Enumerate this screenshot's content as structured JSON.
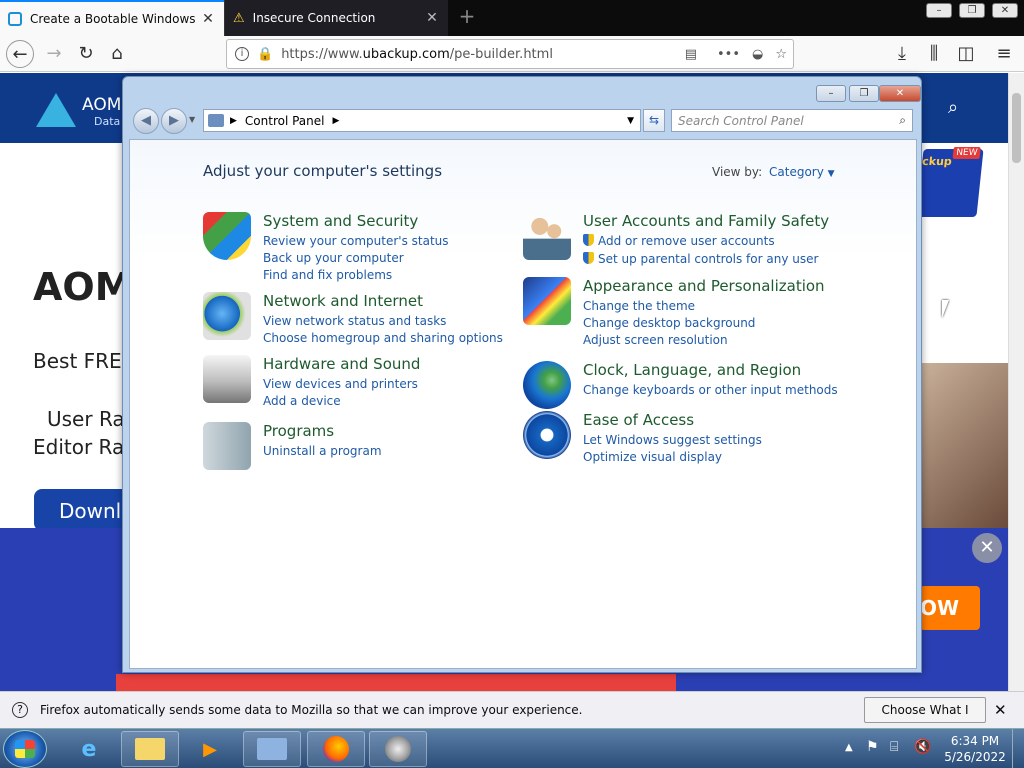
{
  "browser": {
    "tabs": [
      {
        "label": "Create a Bootable Windows PE"
      },
      {
        "label": "Insecure Connection"
      }
    ],
    "url_prefix": "https://www.",
    "url_domain": "ubackup.com",
    "url_path": "/pe-builder.html"
  },
  "page": {
    "logo_text": "AOM",
    "logo_sub": "Data",
    "hero_title": "AOM",
    "hero_sub": "Best FREE",
    "rating1": "User Rat",
    "rating2": "Editor Rat",
    "download": "Downlo",
    "badge_new": "NEW",
    "badge_text": "ckup",
    "cta_suffix": "OW"
  },
  "notification": {
    "message": "Firefox automatically sends some data to Mozilla so that we can improve your experience.",
    "button": "Choose What I Share"
  },
  "control_panel": {
    "breadcrumb": "Control Panel",
    "search_placeholder": "Search Control Panel",
    "heading": "Adjust your computer's settings",
    "view_by_label": "View by:",
    "view_by_value": "Category",
    "left": [
      {
        "title": "System and Security",
        "icon": "shield-icon",
        "links": [
          "Review your computer's status",
          "Back up your computer",
          "Find and fix problems"
        ]
      },
      {
        "title": "Network and Internet",
        "icon": "network-icon",
        "links": [
          "View network status and tasks",
          "Choose homegroup and sharing options"
        ]
      },
      {
        "title": "Hardware and Sound",
        "icon": "printer-icon",
        "links": [
          "View devices and printers",
          "Add a device"
        ]
      },
      {
        "title": "Programs",
        "icon": "programs-icon",
        "links": [
          "Uninstall a program"
        ]
      }
    ],
    "right": [
      {
        "title": "User Accounts and Family Safety",
        "icon": "users-icon",
        "links": [
          "Add or remove user accounts",
          "Set up parental controls for any user"
        ]
      },
      {
        "title": "Appearance and Personalization",
        "icon": "appearance-icon",
        "links": [
          "Change the theme",
          "Change desktop background",
          "Adjust screen resolution"
        ]
      },
      {
        "title": "Clock, Language, and Region",
        "icon": "globe-clock-icon",
        "links": [
          "Change keyboards or other input methods"
        ]
      },
      {
        "title": "Ease of Access",
        "icon": "ease-of-access-icon",
        "links": [
          "Let Windows suggest settings",
          "Optimize visual display"
        ]
      }
    ]
  },
  "taskbar": {
    "time": "6:34 PM",
    "date": "5/26/2022"
  }
}
